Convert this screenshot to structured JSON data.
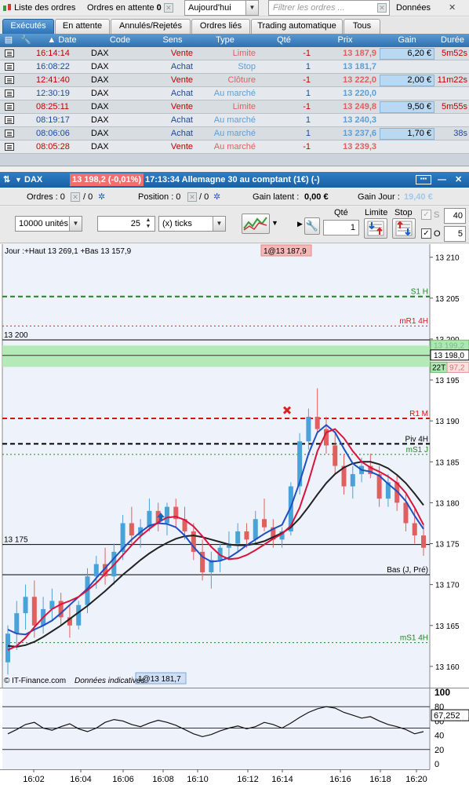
{
  "topbar": {
    "orders_list_label": "Liste des ordres",
    "pending_orders_label": "Ordres en attente",
    "pending_count": "0",
    "date_filter_value": "Aujourd'hui",
    "filter_placeholder": "Filtrer les ordres ...",
    "data_label": "Données"
  },
  "tabs": [
    {
      "label": "Exécutés"
    },
    {
      "label": "En attente"
    },
    {
      "label": "Annulés/Rejetés"
    },
    {
      "label": "Ordres liés"
    },
    {
      "label": "Trading automatique"
    },
    {
      "label": "Tous"
    }
  ],
  "columns": {
    "date": "Date",
    "code": "Code",
    "sens": "Sens",
    "type": "Type",
    "qte": "Qté",
    "prix": "Prix",
    "gain": "Gain",
    "duree": "Durée"
  },
  "orders": [
    {
      "time": "16:14:14",
      "code": "DAX",
      "side": "Vente",
      "type": "Limite",
      "qty": "-1",
      "price": "13 187,9",
      "gain": "6,20 €",
      "duration": "5m52s"
    },
    {
      "time": "16:08:22",
      "code": "DAX",
      "side": "Achat",
      "type": "Stop",
      "qty": "1",
      "price": "13 181,7",
      "gain": "",
      "duration": ""
    },
    {
      "time": "12:41:40",
      "code": "DAX",
      "side": "Vente",
      "type": "Clôture",
      "qty": "-1",
      "price": "13 222,0",
      "gain": "2,00 €",
      "duration": "11m22s"
    },
    {
      "time": "12:30:19",
      "code": "DAX",
      "side": "Achat",
      "type": "Au marché",
      "qty": "1",
      "price": "13 220,0",
      "gain": "",
      "duration": ""
    },
    {
      "time": "08:25:11",
      "code": "DAX",
      "side": "Vente",
      "type": "Limite",
      "qty": "-1",
      "price": "13 249,8",
      "gain": "9,50 €",
      "duration": "5m55s"
    },
    {
      "time": "08:19:17",
      "code": "DAX",
      "side": "Achat",
      "type": "Au marché",
      "qty": "1",
      "price": "13 240,3",
      "gain": "",
      "duration": ""
    },
    {
      "time": "08:06:06",
      "code": "DAX",
      "side": "Achat",
      "type": "Au marché",
      "qty": "1",
      "price": "13 237,6",
      "gain": "1,70 €",
      "duration": "38s"
    },
    {
      "time": "08:05:28",
      "code": "DAX",
      "side": "Vente",
      "type": "Au marché",
      "qty": "-1",
      "price": "13 239,3",
      "gain": "",
      "duration": ""
    }
  ],
  "chart_window": {
    "symbol": "DAX",
    "price_tag": "13 198,2 (-0,01%)",
    "title": "17:13:34 Allemagne 30 au comptant (1€) (-)",
    "orders_label": "Ordres : 0",
    "orders_sep": "/ 0",
    "position_label": "Position : 0",
    "position_sep": "/ 0",
    "latent_label": "Gain latent :",
    "latent_value": "0,00 €",
    "day_gain_label": "Gain Jour :",
    "day_gain_value": "19,40 €"
  },
  "toolbar": {
    "units_value": "10000 unités",
    "ticks_count": "25",
    "ticks_unit": "(x) ticks",
    "qty_label": "Qté",
    "qty_value": "1",
    "limit_label": "Limite",
    "stop_label": "Stop",
    "s_label": "S",
    "s_value": "40",
    "o_label": "O",
    "o_value": "5"
  },
  "chart_texts": {
    "range_text": "Jour :+Haut 13 269,1 +Bas 13 157,9",
    "order_marker": "1@13 187,9",
    "order_marker_bottom": "1@13 181,7",
    "copyright": "© IT-Finance.com",
    "disclaimer": "Données indicatives",
    "left_level_top": "13 200",
    "left_level_bottom": "13 175",
    "current_price": "13 198,0",
    "ask_price": "13 199,2",
    "timer_label": "22T",
    "bid_price": "97,2",
    "line_labels": {
      "s1h": "S1 H",
      "mr1_4h": "mR1 4H",
      "r1m": "R1 M",
      "piv4h": "Piv 4H",
      "ms1j": "mS1 J",
      "bas": "Bas (J, Pré)",
      "ms1_4h": "mS1 4H"
    },
    "osc_value": "67,252"
  },
  "colors": {
    "tab_active": "#2f74b8",
    "header_blue": "#3a7fc1",
    "sell_red": "#c00000",
    "buy_blue": "#1b4a9a",
    "candle_bull": "#4aa3d8",
    "candle_bear": "#e06060",
    "ma_blue": "#1f4fc0",
    "ma_red": "#d8143c",
    "ma_black": "#222222",
    "zone_green": "#aee8b0"
  },
  "chart_data": {
    "type": "candlestick",
    "instrument": "DAX",
    "y_ticks": [
      13210,
      13205,
      13200,
      13195,
      13190,
      13185,
      13180,
      13175,
      13170,
      13165,
      13160
    ],
    "y_tick_labels": [
      "13 210",
      "13 205",
      "13 200",
      "13 195",
      "13 190",
      "13 185",
      "13 180",
      "13 175",
      "13 170",
      "13 165",
      "13 160"
    ],
    "ylim": [
      13157.4,
      13211.6
    ],
    "x_tick_labels": [
      "16:02",
      "16:04",
      "16:06",
      "16:08",
      "16:10",
      "16:12",
      "16:14",
      "16:16",
      "16:18",
      "16:20"
    ],
    "levels": [
      {
        "name": "S1 H",
        "value": 13205.2,
        "color": "#1a8a1a",
        "style": "dash"
      },
      {
        "name": "mR1 4H",
        "value": 13201.6,
        "color": "#cc2222",
        "style": "dot"
      },
      {
        "name": "R1 M",
        "value": 13190.3,
        "color": "#dd1111",
        "style": "dash"
      },
      {
        "name": "Piv 4H",
        "value": 13187.2,
        "color": "#000000",
        "style": "dash"
      },
      {
        "name": "mS1 J",
        "value": 13185.9,
        "color": "#1a8a1a",
        "style": "dot"
      },
      {
        "name": "13 200",
        "value": 13199.9,
        "color": "#000000",
        "style": "solid"
      },
      {
        "name": "13 175",
        "value": 13174.9,
        "color": "#000000",
        "style": "solid"
      },
      {
        "name": "Bas (J, Pré)",
        "value": 13171.2,
        "color": "#000000",
        "style": "solid"
      },
      {
        "name": "mS1 4H",
        "value": 13162.9,
        "color": "#1a8a1a",
        "style": "dot"
      }
    ],
    "zone": {
      "from": 13196.6,
      "to": 13199.2
    },
    "candles": [
      {
        "o": 13160.5,
        "h": 13165.0,
        "l": 13159.0,
        "c": 13164.0
      },
      {
        "o": 13164.0,
        "h": 13168.0,
        "l": 13162.0,
        "c": 13166.5
      },
      {
        "o": 13166.5,
        "h": 13170.0,
        "l": 13164.5,
        "c": 13168.5
      },
      {
        "o": 13168.5,
        "h": 13170.5,
        "l": 13163.5,
        "c": 13165.0
      },
      {
        "o": 13165.0,
        "h": 13168.5,
        "l": 13164.0,
        "c": 13167.0
      },
      {
        "o": 13167.0,
        "h": 13169.5,
        "l": 13165.5,
        "c": 13168.0
      },
      {
        "o": 13168.0,
        "h": 13169.0,
        "l": 13165.0,
        "c": 13166.0
      },
      {
        "o": 13166.0,
        "h": 13167.5,
        "l": 13163.5,
        "c": 13165.0
      },
      {
        "o": 13165.0,
        "h": 13168.0,
        "l": 13164.5,
        "c": 13167.5
      },
      {
        "o": 13167.5,
        "h": 13172.0,
        "l": 13166.5,
        "c": 13171.0
      },
      {
        "o": 13171.0,
        "h": 13173.5,
        "l": 13169.5,
        "c": 13172.5
      },
      {
        "o": 13172.5,
        "h": 13174.5,
        "l": 13170.0,
        "c": 13171.0
      },
      {
        "o": 13171.0,
        "h": 13175.0,
        "l": 13170.0,
        "c": 13174.0
      },
      {
        "o": 13174.0,
        "h": 13178.5,
        "l": 13173.0,
        "c": 13177.5
      },
      {
        "o": 13177.5,
        "h": 13179.5,
        "l": 13175.0,
        "c": 13176.0
      },
      {
        "o": 13176.0,
        "h": 13178.0,
        "l": 13174.5,
        "c": 13177.0
      },
      {
        "o": 13177.0,
        "h": 13180.5,
        "l": 13176.5,
        "c": 13179.0
      },
      {
        "o": 13179.0,
        "h": 13180.0,
        "l": 13176.5,
        "c": 13177.5
      },
      {
        "o": 13177.5,
        "h": 13180.0,
        "l": 13176.0,
        "c": 13179.5
      },
      {
        "o": 13179.5,
        "h": 13180.5,
        "l": 13177.0,
        "c": 13178.0
      },
      {
        "o": 13178.0,
        "h": 13179.5,
        "l": 13175.5,
        "c": 13176.5
      },
      {
        "o": 13176.5,
        "h": 13177.5,
        "l": 13173.0,
        "c": 13174.0
      },
      {
        "o": 13174.0,
        "h": 13175.5,
        "l": 13170.5,
        "c": 13171.5
      },
      {
        "o": 13171.5,
        "h": 13174.0,
        "l": 13169.5,
        "c": 13173.0
      },
      {
        "o": 13173.0,
        "h": 13175.0,
        "l": 13171.5,
        "c": 13174.5
      },
      {
        "o": 13174.5,
        "h": 13176.5,
        "l": 13173.0,
        "c": 13175.0
      },
      {
        "o": 13175.0,
        "h": 13177.5,
        "l": 13174.0,
        "c": 13176.5
      },
      {
        "o": 13176.5,
        "h": 13177.5,
        "l": 13174.5,
        "c": 13175.5
      },
      {
        "o": 13175.5,
        "h": 13179.0,
        "l": 13175.0,
        "c": 13178.0
      },
      {
        "o": 13178.0,
        "h": 13180.5,
        "l": 13176.5,
        "c": 13177.0
      },
      {
        "o": 13177.0,
        "h": 13178.0,
        "l": 13174.5,
        "c": 13175.5
      },
      {
        "o": 13175.5,
        "h": 13177.0,
        "l": 13174.5,
        "c": 13176.5
      },
      {
        "o": 13176.5,
        "h": 13182.5,
        "l": 13176.0,
        "c": 13182.0
      },
      {
        "o": 13182.0,
        "h": 13188.5,
        "l": 13181.0,
        "c": 13187.5
      },
      {
        "o": 13187.5,
        "h": 13191.5,
        "l": 13186.5,
        "c": 13190.5
      },
      {
        "o": 13190.5,
        "h": 13194.0,
        "l": 13188.5,
        "c": 13189.0
      },
      {
        "o": 13189.0,
        "h": 13190.5,
        "l": 13186.0,
        "c": 13187.0
      },
      {
        "o": 13187.0,
        "h": 13188.5,
        "l": 13183.5,
        "c": 13184.5
      },
      {
        "o": 13184.5,
        "h": 13186.0,
        "l": 13181.0,
        "c": 13182.0
      },
      {
        "o": 13182.0,
        "h": 13184.5,
        "l": 13180.5,
        "c": 13183.5
      },
      {
        "o": 13183.5,
        "h": 13185.5,
        "l": 13182.5,
        "c": 13184.5
      },
      {
        "o": 13184.5,
        "h": 13186.0,
        "l": 13183.0,
        "c": 13183.5
      },
      {
        "o": 13183.5,
        "h": 13184.5,
        "l": 13179.5,
        "c": 13180.5
      },
      {
        "o": 13180.5,
        "h": 13183.5,
        "l": 13179.5,
        "c": 13182.5
      },
      {
        "o": 13182.5,
        "h": 13183.5,
        "l": 13179.0,
        "c": 13180.0
      },
      {
        "o": 13180.0,
        "h": 13181.0,
        "l": 13176.5,
        "c": 13177.5
      },
      {
        "o": 13177.5,
        "h": 13179.5,
        "l": 13175.0,
        "c": 13176.0
      },
      {
        "o": 13176.0,
        "h": 13177.5,
        "l": 13173.5,
        "c": 13174.5
      }
    ],
    "ma_blue": [
      13164.5,
      13164.0,
      13163.9,
      13164.5,
      13165.0,
      13165.6,
      13166.5,
      13167.5,
      13168.5,
      13169.5,
      13170.8,
      13172.0,
      13173.2,
      13174.4,
      13175.5,
      13176.4,
      13177.2,
      13177.5,
      13177.4,
      13177.0,
      13176.0,
      13174.6,
      13173.4,
      13172.8,
      13172.9,
      13173.3,
      13174.0,
      13174.8,
      13175.5,
      13176.2,
      13176.8,
      13177.3,
      13179.5,
      13182.5,
      13186.0,
      13188.6,
      13189.5,
      13188.6,
      13186.6,
      13184.8,
      13184.0,
      13183.8,
      13183.3,
      13182.3,
      13181.4,
      13180.2,
      13178.4,
      13176.8
    ],
    "ma_red": [
      13162.0,
      13162.5,
      13163.5,
      13164.8,
      13166.0,
      13167.0,
      13167.6,
      13168.0,
      13168.5,
      13169.3,
      13170.2,
      13171.3,
      13172.4,
      13173.6,
      13174.8,
      13175.9,
      13176.8,
      13177.6,
      13178.2,
      13178.3,
      13177.9,
      13177.1,
      13175.9,
      13174.6,
      13173.6,
      13173.1,
      13173.2,
      13173.6,
      13174.2,
      13174.9,
      13175.6,
      13176.2,
      13177.2,
      13179.4,
      13182.6,
      13186.3,
      13188.6,
      13189.0,
      13187.9,
      13186.3,
      13185.0,
      13184.3,
      13183.8,
      13183.2,
      13182.4,
      13181.2,
      13179.4,
      13177.3
    ],
    "ma_black": [
      13162.5,
      13162.4,
      13162.6,
      13163.0,
      13163.6,
      13164.3,
      13165.0,
      13165.8,
      13166.6,
      13167.4,
      13168.3,
      13169.2,
      13170.2,
      13171.2,
      13172.1,
      13173.0,
      13173.8,
      13174.5,
      13175.1,
      13175.6,
      13175.9,
      13176.0,
      13175.8,
      13175.5,
      13175.2,
      13174.9,
      13174.8,
      13174.8,
      13175.0,
      13175.3,
      13175.8,
      13176.3,
      13177.0,
      13178.1,
      13179.5,
      13181.0,
      13182.4,
      13183.5,
      13184.3,
      13184.8,
      13185.0,
      13185.0,
      13184.7,
      13184.2,
      13183.4,
      13182.4,
      13181.1,
      13179.7
    ],
    "oscillator": {
      "ylim": [
        0,
        100
      ],
      "y_tick_labels": [
        "100",
        "80",
        "60",
        "40",
        "20",
        "0"
      ],
      "levels": [
        80,
        50,
        20
      ],
      "values": [
        42,
        48,
        55,
        58,
        50,
        47,
        52,
        56,
        49,
        45,
        50,
        58,
        62,
        60,
        55,
        52,
        57,
        61,
        58,
        54,
        48,
        42,
        38,
        41,
        46,
        50,
        53,
        49,
        52,
        58,
        55,
        50,
        57,
        65,
        72,
        77,
        80,
        78,
        72,
        68,
        64,
        66,
        60,
        55,
        52,
        48,
        42,
        45
      ]
    }
  }
}
